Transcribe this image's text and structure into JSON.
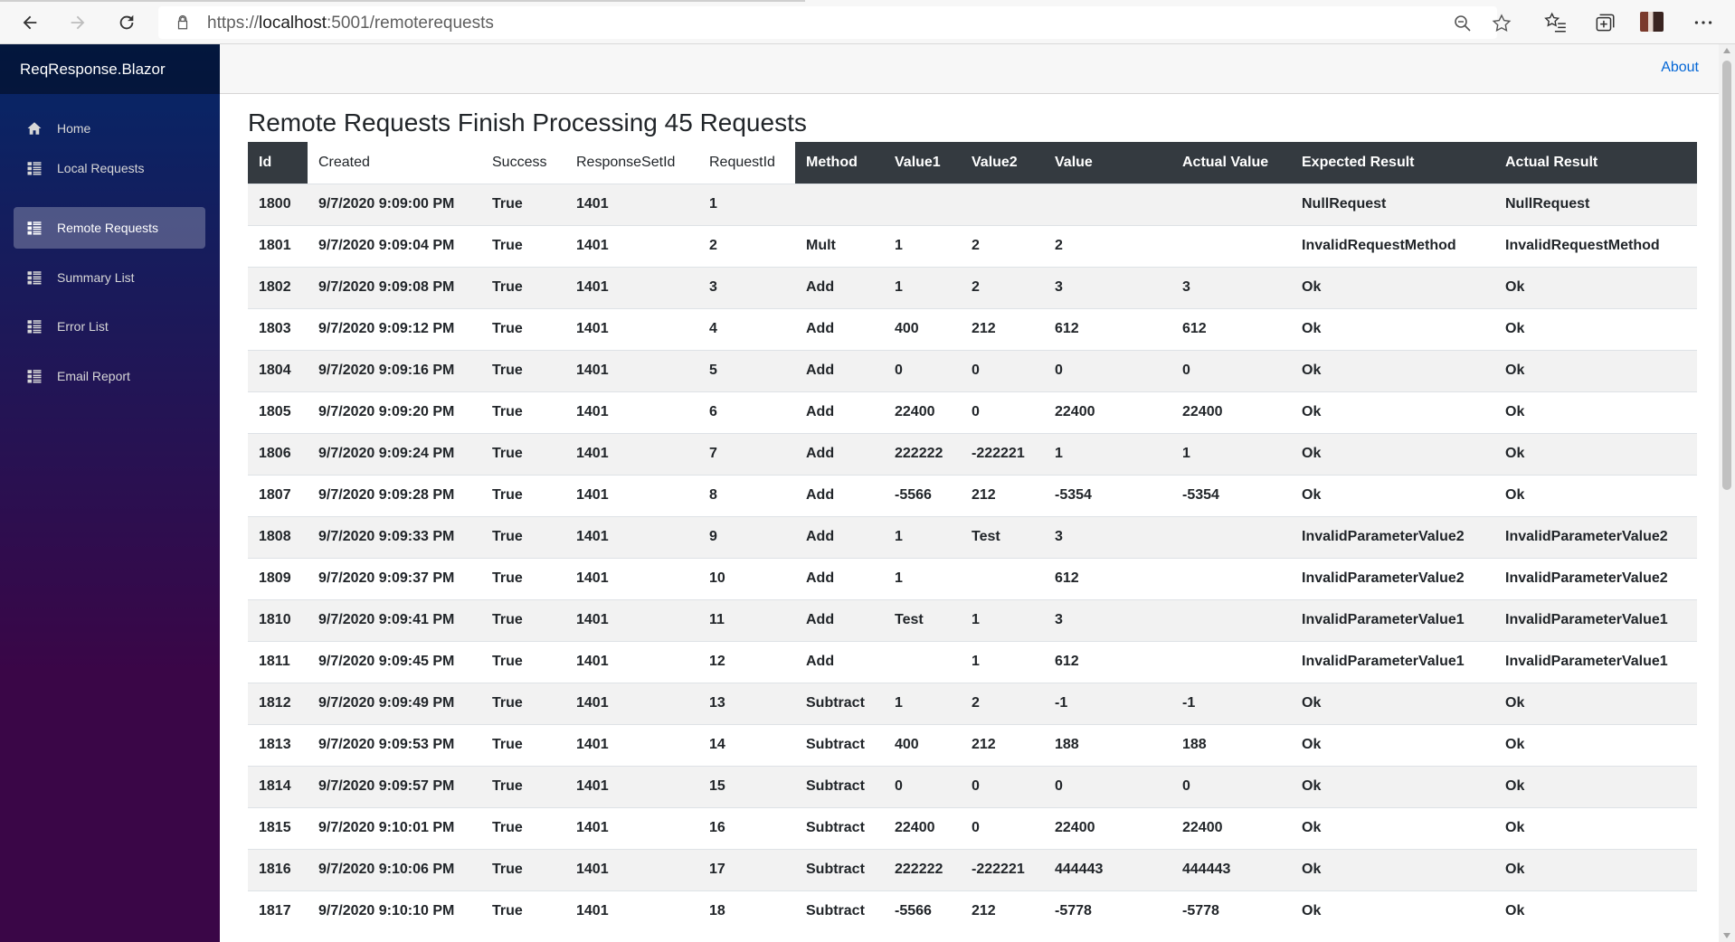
{
  "browser": {
    "url_scheme": "https://",
    "url_host": "localhost",
    "url_rest": ":5001/remoterequests"
  },
  "sidebar": {
    "brand": "ReqResponse.Blazor",
    "items": [
      {
        "label": "Home",
        "icon": "home-icon"
      },
      {
        "label": "Local Requests",
        "icon": "list-icon"
      },
      {
        "label": "Remote Requests",
        "icon": "list-icon",
        "active": true
      },
      {
        "label": "Summary List",
        "icon": "list-icon"
      },
      {
        "label": "Error List",
        "icon": "list-icon"
      },
      {
        "label": "Email Report",
        "icon": "list-icon"
      }
    ]
  },
  "header": {
    "about": "About"
  },
  "page": {
    "title": "Remote Requests Finish Processing 45 Requests"
  },
  "table": {
    "columns": [
      "Id",
      "Created",
      "Success",
      "ResponseSetId",
      "RequestId",
      "Method",
      "Value1",
      "Value2",
      "Value",
      "Actual Value",
      "Expected Result",
      "Actual Result"
    ],
    "rows": [
      [
        "1800",
        "9/7/2020 9:09:00 PM",
        "True",
        "1401",
        "1",
        "",
        "",
        "",
        "",
        "",
        "NullRequest",
        "NullRequest"
      ],
      [
        "1801",
        "9/7/2020 9:09:04 PM",
        "True",
        "1401",
        "2",
        "Mult",
        "1",
        "2",
        "2",
        "",
        "InvalidRequestMethod",
        "InvalidRequestMethod"
      ],
      [
        "1802",
        "9/7/2020 9:09:08 PM",
        "True",
        "1401",
        "3",
        "Add",
        "1",
        "2",
        "3",
        "3",
        "Ok",
        "Ok"
      ],
      [
        "1803",
        "9/7/2020 9:09:12 PM",
        "True",
        "1401",
        "4",
        "Add",
        "400",
        "212",
        "612",
        "612",
        "Ok",
        "Ok"
      ],
      [
        "1804",
        "9/7/2020 9:09:16 PM",
        "True",
        "1401",
        "5",
        "Add",
        "0",
        "0",
        "0",
        "0",
        "Ok",
        "Ok"
      ],
      [
        "1805",
        "9/7/2020 9:09:20 PM",
        "True",
        "1401",
        "6",
        "Add",
        "22400",
        "0",
        "22400",
        "22400",
        "Ok",
        "Ok"
      ],
      [
        "1806",
        "9/7/2020 9:09:24 PM",
        "True",
        "1401",
        "7",
        "Add",
        "222222",
        "-222221",
        "1",
        "1",
        "Ok",
        "Ok"
      ],
      [
        "1807",
        "9/7/2020 9:09:28 PM",
        "True",
        "1401",
        "8",
        "Add",
        "-5566",
        "212",
        "-5354",
        "-5354",
        "Ok",
        "Ok"
      ],
      [
        "1808",
        "9/7/2020 9:09:33 PM",
        "True",
        "1401",
        "9",
        "Add",
        "1",
        "Test",
        "3",
        "",
        "InvalidParameterValue2",
        "InvalidParameterValue2"
      ],
      [
        "1809",
        "9/7/2020 9:09:37 PM",
        "True",
        "1401",
        "10",
        "Add",
        "1",
        "",
        "612",
        "",
        "InvalidParameterValue2",
        "InvalidParameterValue2"
      ],
      [
        "1810",
        "9/7/2020 9:09:41 PM",
        "True",
        "1401",
        "11",
        "Add",
        "Test",
        "1",
        "3",
        "",
        "InvalidParameterValue1",
        "InvalidParameterValue1"
      ],
      [
        "1811",
        "9/7/2020 9:09:45 PM",
        "True",
        "1401",
        "12",
        "Add",
        "",
        "1",
        "612",
        "",
        "InvalidParameterValue1",
        "InvalidParameterValue1"
      ],
      [
        "1812",
        "9/7/2020 9:09:49 PM",
        "True",
        "1401",
        "13",
        "Subtract",
        "1",
        "2",
        "-1",
        "-1",
        "Ok",
        "Ok"
      ],
      [
        "1813",
        "9/7/2020 9:09:53 PM",
        "True",
        "1401",
        "14",
        "Subtract",
        "400",
        "212",
        "188",
        "188",
        "Ok",
        "Ok"
      ],
      [
        "1814",
        "9/7/2020 9:09:57 PM",
        "True",
        "1401",
        "15",
        "Subtract",
        "0",
        "0",
        "0",
        "0",
        "Ok",
        "Ok"
      ],
      [
        "1815",
        "9/7/2020 9:10:01 PM",
        "True",
        "1401",
        "16",
        "Subtract",
        "22400",
        "0",
        "22400",
        "22400",
        "Ok",
        "Ok"
      ],
      [
        "1816",
        "9/7/2020 9:10:06 PM",
        "True",
        "1401",
        "17",
        "Subtract",
        "222222",
        "-222221",
        "444443",
        "444443",
        "Ok",
        "Ok"
      ],
      [
        "1817",
        "9/7/2020 9:10:10 PM",
        "True",
        "1401",
        "18",
        "Subtract",
        "-5566",
        "212",
        "-5778",
        "-5778",
        "Ok",
        "Ok"
      ]
    ]
  },
  "colors": {
    "sidebar_top": "#052767",
    "sidebar_bottom": "#3a0647",
    "header_dark": "#343a40",
    "link": "#0366d6"
  }
}
